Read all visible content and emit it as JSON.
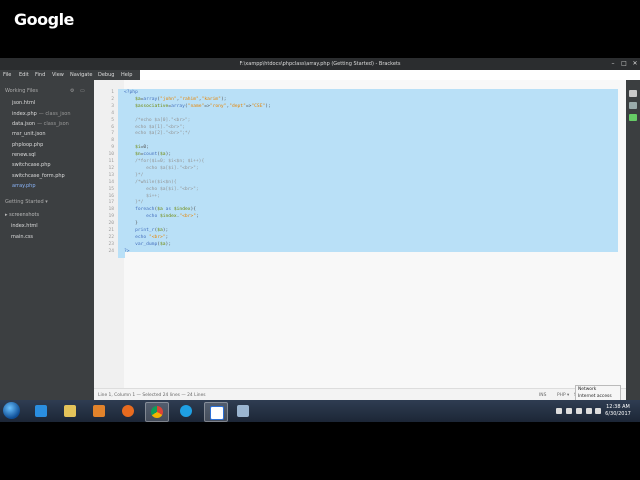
{
  "window": {
    "title": "F:\\xampp\\htdocs\\phpclass\\array.php (Getting Started) - Brackets"
  },
  "google_logo": "Google",
  "menu": [
    "File",
    "Edit",
    "Find",
    "View",
    "Navigate",
    "Debug",
    "Help"
  ],
  "sidebar": {
    "working_files_title": "Working Files",
    "working_files": [
      {
        "name": "json.html",
        "sub": ""
      },
      {
        "name": "index.php",
        "sub": "— class_json"
      },
      {
        "name": "data.json",
        "sub": "— class_json"
      },
      {
        "name": "msr_unit.json",
        "sub": ""
      },
      {
        "name": "phploop.php",
        "sub": ""
      },
      {
        "name": "renew.sql",
        "sub": ""
      },
      {
        "name": "switchcase.php",
        "sub": ""
      },
      {
        "name": "switchcase_form.php",
        "sub": ""
      },
      {
        "name": "array.php",
        "sub": ""
      }
    ],
    "project_title": "Getting Started ▾",
    "project_folder": "▸ screenshots",
    "project_files": [
      "index.html",
      "main.css"
    ]
  },
  "editor": {
    "lines": [
      "<?php",
      "    $a=array(\"john\",\"rahim\",\"karim\");",
      "    $associative=array(\"name\"=>\"rony\",\"dept\"=>\"CSE\");",
      "",
      "    /*echo $a[0].\"<br>\";",
      "    echo $a[1].\"<br>\";",
      "    echo $a[2].\"<br>\";*/",
      "",
      "    $i=0;",
      "    $n=count($a);",
      "    /*for($i=0; $i<$n; $i++){",
      "        echo $a[$i].\"<br>\";",
      "    }*/",
      "    /*while($i<$n){",
      "        echo $a[$i].\"<br>\";",
      "        $i++;",
      "    }*/",
      "    foreach($a as $index){",
      "        echo $index.\"<br>\";",
      "    }",
      "    print_r($a);",
      "    echo \"<br>\";",
      "    var_dump($a);",
      "?>"
    ]
  },
  "statusbar": {
    "position": "Line 1, Column 1 — Selected 24 lines",
    "line_count": "24 Lines",
    "mode": "INS",
    "language": "PHP ▾",
    "spaces": "Spaces: 4"
  },
  "tooltip": {
    "line1": "Network",
    "line2": "Internet access"
  },
  "clock": {
    "time": "12:38 AM",
    "date": "6/30/2017"
  },
  "colors": {
    "selection": "#b9e0f7",
    "sidebar": "#3c3f41",
    "taskbar": "#1c2636"
  }
}
